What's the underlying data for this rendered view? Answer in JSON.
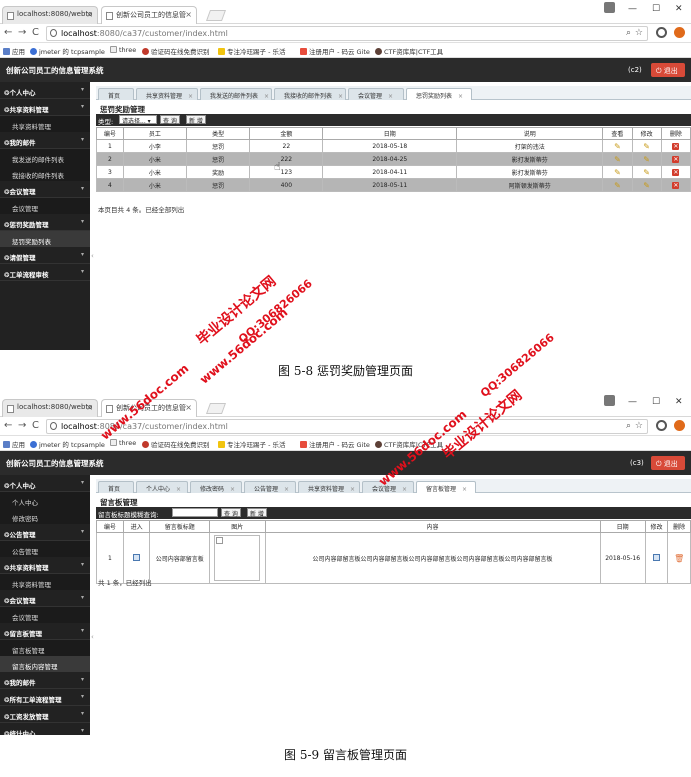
{
  "screenshot1": {
    "browser": {
      "tabs": [
        {
          "title": "localhost:8080/webto"
        },
        {
          "title": "创新公司员工的信息管"
        }
      ],
      "address": {
        "host": "localhost",
        "path": ":8080/ca37/customer/index.html"
      },
      "bookmarks": [
        "应用",
        "jmeter 的 tcpsample",
        "three",
        "验证码在线免费识别",
        "专注冷珏踢子 - 乐活",
        "注册用户 - 码云 Gite",
        "CTF资库库|CTF工具"
      ]
    },
    "app": {
      "title": "创新公司员工的信息管理系统",
      "user": "(c2)",
      "logout": "退出"
    },
    "sidebar": [
      {
        "type": "section",
        "label": "个人中心"
      },
      {
        "type": "section",
        "label": "共享资料管理"
      },
      {
        "type": "item",
        "label": "共享资料管理"
      },
      {
        "type": "section",
        "label": "我的邮件"
      },
      {
        "type": "item",
        "label": "我发送的邮件列表"
      },
      {
        "type": "item",
        "label": "我接收的邮件列表"
      },
      {
        "type": "section",
        "label": "会议管理"
      },
      {
        "type": "item",
        "label": "会议管理"
      },
      {
        "type": "section",
        "label": "惩罚奖励管理"
      },
      {
        "type": "item",
        "label": "惩罚奖励列表",
        "selected": true
      },
      {
        "type": "section",
        "label": "请假管理"
      },
      {
        "type": "section",
        "label": "工单流程审核"
      }
    ],
    "content_tabs": [
      {
        "label": "首页"
      },
      {
        "label": "共享资料管理",
        "closable": true
      },
      {
        "label": "我发送的邮件列表",
        "closable": true
      },
      {
        "label": "我接收的邮件列表",
        "closable": true
      },
      {
        "label": "会议管理",
        "closable": true
      },
      {
        "label": "惩罚奖励列表",
        "closable": true,
        "active": true
      }
    ],
    "panel_title": "惩罚奖励管理",
    "toolbar": {
      "label": "类型:",
      "select_value": "请选择...",
      "query": "查 询",
      "add": "新 增"
    },
    "table": {
      "columns": [
        "编号",
        "员工",
        "类型",
        "金额",
        "日期",
        "说明",
        "查看",
        "修改",
        "删除"
      ],
      "rows": [
        [
          "1",
          "小李",
          "惩罚",
          "22",
          "2018-05-18",
          "打架的违法"
        ],
        [
          "2",
          "小米",
          "惩罚",
          "222",
          "2018-04-25",
          "影打发斯蒂芬"
        ],
        [
          "3",
          "小米",
          "奖励",
          "123",
          "2018-04-11",
          "影打发斯蒂芬"
        ],
        [
          "4",
          "小米",
          "惩罚",
          "400",
          "2018-05-11",
          "阿斯顿发斯蒂芬"
        ]
      ]
    },
    "footer": "本页目共 4 条。已经全部列出"
  },
  "caption1": "图 5-8 惩罚奖励管理页面",
  "screenshot2": {
    "browser": {
      "tabs": [
        {
          "title": "localhost:8080/webto"
        },
        {
          "title": "创新公司员工的信息管"
        }
      ],
      "address": {
        "host": "localhost",
        "path": ":8080/ca37/customer/index.html"
      },
      "bookmarks": [
        "应用",
        "jmeter 的 tcpsample",
        "three",
        "验证码在线免费识别",
        "专注冷珏踢子 - 乐活",
        "注册用户 - 码云 Gite",
        "CTF资库库|CTF工具"
      ]
    },
    "app": {
      "title": "创新公司员工的信息管理系统",
      "user": "(c3)",
      "logout": "退出"
    },
    "sidebar": [
      {
        "type": "section",
        "label": "个人中心"
      },
      {
        "type": "item",
        "label": "个人中心"
      },
      {
        "type": "item",
        "label": "修改密码"
      },
      {
        "type": "section",
        "label": "公告管理"
      },
      {
        "type": "item",
        "label": "公告管理"
      },
      {
        "type": "section",
        "label": "共享资料管理"
      },
      {
        "type": "item",
        "label": "共享资料管理"
      },
      {
        "type": "section",
        "label": "会议管理"
      },
      {
        "type": "item",
        "label": "会议管理"
      },
      {
        "type": "section",
        "label": "留言板管理"
      },
      {
        "type": "item",
        "label": "留言板管理"
      },
      {
        "type": "item",
        "label": "留言板内容管理",
        "selected": true
      },
      {
        "type": "section",
        "label": "我的邮件"
      },
      {
        "type": "section",
        "label": "所有工单流程管理"
      },
      {
        "type": "section",
        "label": "工资发放管理"
      },
      {
        "type": "section",
        "label": "统计中心"
      }
    ],
    "content_tabs": [
      {
        "label": "首页"
      },
      {
        "label": "个人中心",
        "closable": true
      },
      {
        "label": "修改密码",
        "closable": true
      },
      {
        "label": "公告管理",
        "closable": true
      },
      {
        "label": "共享资料管理",
        "closable": true
      },
      {
        "label": "会议管理",
        "closable": true
      },
      {
        "label": "留言板管理",
        "closable": true,
        "active": true
      }
    ],
    "panel_title": "留言板管理",
    "toolbar": {
      "label": "留言板标题模糊查询:",
      "query": "查 询",
      "add": "新 增"
    },
    "table": {
      "columns": [
        "编号",
        "进入",
        "留言板标题",
        "图片",
        "内容",
        "日期",
        "修改",
        "删除"
      ],
      "rows": [
        [
          "1",
          "",
          "公司内容部留言板",
          "",
          "公司内容部留言板公司内容部留言板公司内容部留言板公司内容部留言板公司内容部留言板",
          "2018-05-16"
        ]
      ]
    },
    "footer": "共 1 条，已经列出"
  },
  "caption2": "图 5-9 留言板管理页面",
  "watermark": {
    "site_cn": "毕业设计论文网",
    "site_url": "www.56doc.com",
    "qq": "QQ:306826066"
  }
}
